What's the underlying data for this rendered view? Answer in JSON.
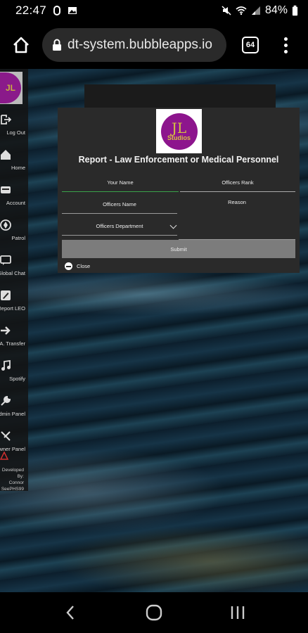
{
  "status_bar": {
    "time": "22:47",
    "battery": "84%"
  },
  "browser": {
    "url": "dt-system.bubbleapps.io",
    "tab_count": "64"
  },
  "sidebar": {
    "logo_text": "JL",
    "items": [
      {
        "label": "Log Out",
        "icon": "logout-icon"
      },
      {
        "label": "Home",
        "icon": "home-icon"
      },
      {
        "label": "Account",
        "icon": "account-icon"
      },
      {
        "label": "Patrol",
        "icon": "patrol-icon"
      },
      {
        "label": "Global Chat",
        "icon": "chat-icon"
      },
      {
        "label": "Report LEO",
        "icon": "report-icon"
      },
      {
        "label": "A. Transfer",
        "icon": "transfer-icon"
      },
      {
        "label": "Spotify",
        "icon": "music-icon"
      },
      {
        "label": "Admin Panel",
        "icon": "wrench-icon"
      },
      {
        "label": "Owner Panel",
        "icon": "tools-icon"
      }
    ],
    "credit": [
      "Developed By:",
      "Connor",
      "SeePHS99"
    ]
  },
  "modal": {
    "logo_top": "JL",
    "logo_bottom": "Studios",
    "title": "Report - Law Enforcement or Medical Personnel",
    "fields": {
      "your_name": "Your Name",
      "officers_rank": "Officers Rank",
      "officers_name": "Officers Name",
      "reason": "Reason",
      "officers_department": "Officers Department"
    },
    "submit_label": "Submit",
    "close_label": "Close"
  },
  "colors": {
    "logo_purple": "#8d158d",
    "logo_gold": "#d4c041",
    "active_underline": "#3aa24a",
    "modal_bg": "#2a2a2a"
  }
}
